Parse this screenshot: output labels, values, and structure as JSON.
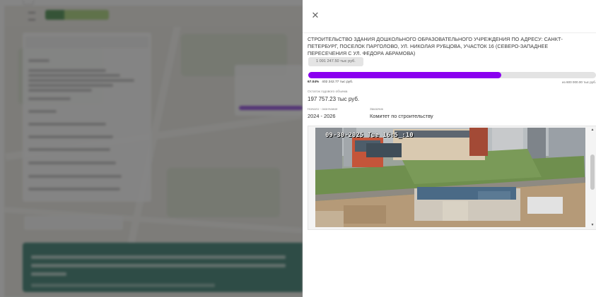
{
  "project": {
    "title": "Строительство здания дошкольного образовательного учреждения по адресу: Санкт-Петербург, поселок Парголово, ул. Николая Рубцова, участок 16 (северо-западнее пересечения с ул. Федора Абрамова)",
    "cost": "1 091 247.50 тыс руб.",
    "progress_percent": 67.04,
    "progress_percent_label": "67.04%",
    "progress_amount": "402 242.77 тыс руб.",
    "progress_total": "из 600 000.00 тыс руб.",
    "remainder_label": "Остаток годового объема",
    "remainder_value": "197 757.23 тыс руб.",
    "period_label": "Начало - окончание",
    "period_value": "2024 - 2026",
    "customer_label": "Заказчик",
    "customer_value": "Комитет по строительству"
  },
  "drawer": {
    "close_icon": "✕"
  },
  "camera": {
    "timestamp": "09-30-2025 Tue 16:5_:10",
    "scroll_up_icon": "▲",
    "scroll_down_icon": "▼"
  },
  "colors": {
    "accent": "#8a00f0",
    "overlay": "#3a3a3a",
    "banner": "#1c6a5a"
  }
}
